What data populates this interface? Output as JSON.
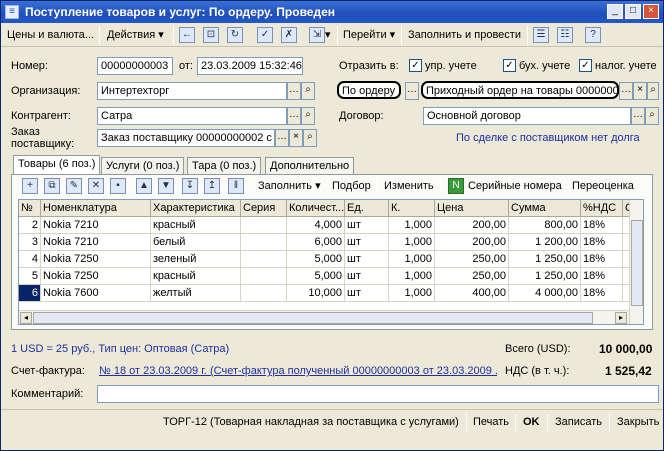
{
  "window": {
    "title": "Поступление товаров и услуг: По ордеру. Проведен",
    "controls": [
      "_",
      "□",
      "×"
    ]
  },
  "toolbar": {
    "prices_label": "Цены и валюта...",
    "actions_label": "Действия",
    "go_label": "Перейти",
    "fill_and_post_label": "Заполнить и провести"
  },
  "form": {
    "number_label": "Номер:",
    "number_value": "00000000003",
    "from_label": "от:",
    "date_value": "23.03.2009 15:32:46",
    "reflect_label": "Отразить в:",
    "reflect_mgmt": "упр. учете",
    "reflect_acc": "бух. учете",
    "reflect_tax": "налог. учете",
    "org_label": "Организация:",
    "org_value": "Интертехторг",
    "by_order_value": "По ордеру",
    "order_doc_value": "Приходный ордер на товары 0000000",
    "contractor_label": "Контрагент:",
    "contractor_value": "Сатра",
    "contract_label": "Договор:",
    "contract_value": "Основной договор",
    "supplier_order_label1": "Заказ",
    "supplier_order_label2": "поставщику:",
    "supplier_order_value": "Заказ поставщику 00000000002 с",
    "deal_link": "По сделке с поставщиком нет долга"
  },
  "tabs": [
    "Товары (6 поз.)",
    "Услуги (0 поз.)",
    "Тара (0 поз.)",
    "Дополнительно"
  ],
  "table_toolbar": {
    "fill_label": "Заполнить",
    "select_label": "Подбор",
    "change_label": "Изменить",
    "serial_label": "Серийные номера",
    "revalue_label": "Переоценка"
  },
  "table": {
    "columns": [
      "№",
      "Номенклатура",
      "Характеристика",
      "Серия",
      "Количест...",
      "Ед.",
      "К.",
      "Цена",
      "Сумма",
      "%НДС",
      "Су"
    ],
    "rows": [
      [
        "2",
        "Nokia 7210",
        "красный",
        "",
        "4,000",
        "шт",
        "1,000",
        "200,00",
        "800,00",
        "18%",
        ""
      ],
      [
        "3",
        "Nokia 7210",
        "белый",
        "",
        "6,000",
        "шт",
        "1,000",
        "200,00",
        "1 200,00",
        "18%",
        ""
      ],
      [
        "4",
        "Nokia 7250",
        "зеленый",
        "",
        "5,000",
        "шт",
        "1,000",
        "250,00",
        "1 250,00",
        "18%",
        ""
      ],
      [
        "5",
        "Nokia 7250",
        "красный",
        "",
        "5,000",
        "шт",
        "1,000",
        "250,00",
        "1 250,00",
        "18%",
        ""
      ],
      [
        "6",
        "Nokia 7600",
        "желтый",
        "",
        "10,000",
        "шт",
        "1,000",
        "400,00",
        "4 000,00",
        "18%",
        ""
      ]
    ]
  },
  "footer": {
    "currency_link": "1 USD = 25 руб., Тип цен: Оптовая (Сатра)",
    "total_label": "Всего (USD):",
    "total_value": "10 000,00",
    "invoice_label": "Счет-фактура:",
    "invoice_link": "№ 18 от 23.03.2009 г. (Счет-фактура полученный 00000000003 от 23.03.2009 ...",
    "vat_label": "НДС (в т. ч.):",
    "vat_value": "1 525,42",
    "comment_label": "Комментарий:",
    "comment_value": ""
  },
  "bottom": {
    "torg_label": "ТОРГ-12 (Товарная накладная за поставщика с услугами)",
    "print_label": "Печать",
    "ok_label": "OK",
    "save_label": "Записать",
    "close_label": "Закрыть"
  }
}
